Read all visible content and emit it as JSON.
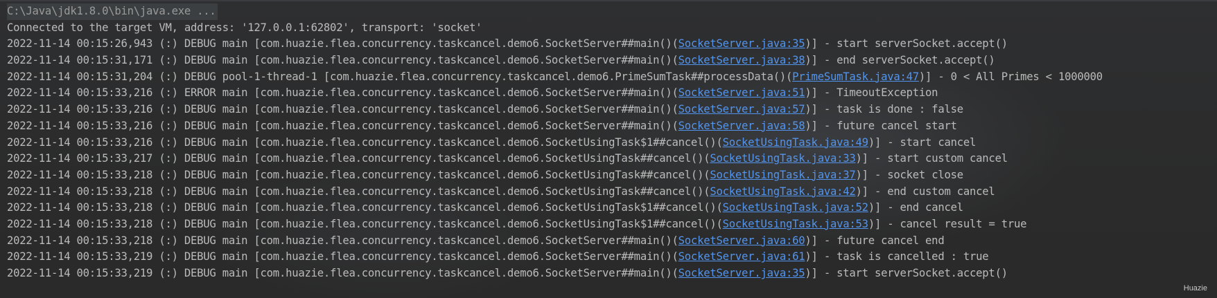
{
  "console": {
    "command": "C:\\Java\\jdk1.8.0\\bin\\java.exe ...",
    "connected": "Connected to the target VM, address: '127.0.0.1:62802', transport: 'socket'",
    "lines": [
      {
        "pre": "2022-11-14 00:15:26,943 (:) DEBUG main [com.huazie.flea.concurrency.taskcancel.demo6.SocketServer##main()(",
        "link": "SocketServer.java:35",
        "post": ")] - start serverSocket.accept()"
      },
      {
        "pre": "2022-11-14 00:15:31,171 (:) DEBUG main [com.huazie.flea.concurrency.taskcancel.demo6.SocketServer##main()(",
        "link": "SocketServer.java:38",
        "post": ")] - end serverSocket.accept()"
      },
      {
        "pre": "2022-11-14 00:15:31,204 (:) DEBUG pool-1-thread-1 [com.huazie.flea.concurrency.taskcancel.demo6.PrimeSumTask##processData()(",
        "link": "PrimeSumTask.java:47",
        "post": ")] - 0 < All Primes < 1000000"
      },
      {
        "pre": "2022-11-14 00:15:33,216 (:) ERROR main [com.huazie.flea.concurrency.taskcancel.demo6.SocketServer##main()(",
        "link": "SocketServer.java:51",
        "post": ")] - TimeoutException"
      },
      {
        "pre": "2022-11-14 00:15:33,216 (:) DEBUG main [com.huazie.flea.concurrency.taskcancel.demo6.SocketServer##main()(",
        "link": "SocketServer.java:57",
        "post": ")] - task is done : false"
      },
      {
        "pre": "2022-11-14 00:15:33,216 (:) DEBUG main [com.huazie.flea.concurrency.taskcancel.demo6.SocketServer##main()(",
        "link": "SocketServer.java:58",
        "post": ")] - future cancel start"
      },
      {
        "pre": "2022-11-14 00:15:33,216 (:) DEBUG main [com.huazie.flea.concurrency.taskcancel.demo6.SocketUsingTask$1##cancel()(",
        "link": "SocketUsingTask.java:49",
        "post": ")] - start cancel"
      },
      {
        "pre": "2022-11-14 00:15:33,217 (:) DEBUG main [com.huazie.flea.concurrency.taskcancel.demo6.SocketUsingTask##cancel()(",
        "link": "SocketUsingTask.java:33",
        "post": ")] - start custom cancel"
      },
      {
        "pre": "2022-11-14 00:15:33,218 (:) DEBUG main [com.huazie.flea.concurrency.taskcancel.demo6.SocketUsingTask##cancel()(",
        "link": "SocketUsingTask.java:37",
        "post": ")] - socket close"
      },
      {
        "pre": "2022-11-14 00:15:33,218 (:) DEBUG main [com.huazie.flea.concurrency.taskcancel.demo6.SocketUsingTask##cancel()(",
        "link": "SocketUsingTask.java:42",
        "post": ")] - end custom cancel"
      },
      {
        "pre": "2022-11-14 00:15:33,218 (:) DEBUG main [com.huazie.flea.concurrency.taskcancel.demo6.SocketUsingTask$1##cancel()(",
        "link": "SocketUsingTask.java:52",
        "post": ")] - end cancel"
      },
      {
        "pre": "2022-11-14 00:15:33,218 (:) DEBUG main [com.huazie.flea.concurrency.taskcancel.demo6.SocketUsingTask$1##cancel()(",
        "link": "SocketUsingTask.java:53",
        "post": ")] - cancel result = true"
      },
      {
        "pre": "2022-11-14 00:15:33,218 (:) DEBUG main [com.huazie.flea.concurrency.taskcancel.demo6.SocketServer##main()(",
        "link": "SocketServer.java:60",
        "post": ")] - future cancel end"
      },
      {
        "pre": "2022-11-14 00:15:33,219 (:) DEBUG main [com.huazie.flea.concurrency.taskcancel.demo6.SocketServer##main()(",
        "link": "SocketServer.java:61",
        "post": ")] - task is cancelled : true"
      },
      {
        "pre": "2022-11-14 00:15:33,219 (:) DEBUG main [com.huazie.flea.concurrency.taskcancel.demo6.SocketServer##main()(",
        "link": "SocketServer.java:35",
        "post": ")] - start serverSocket.accept()"
      }
    ]
  },
  "watermark": "Huazie",
  "colors": {
    "background": "#2b2b2b",
    "text": "#bbbbbb",
    "link": "#5394ec",
    "command_text": "#9a9a9a",
    "command_highlight": "#3c3f41"
  }
}
